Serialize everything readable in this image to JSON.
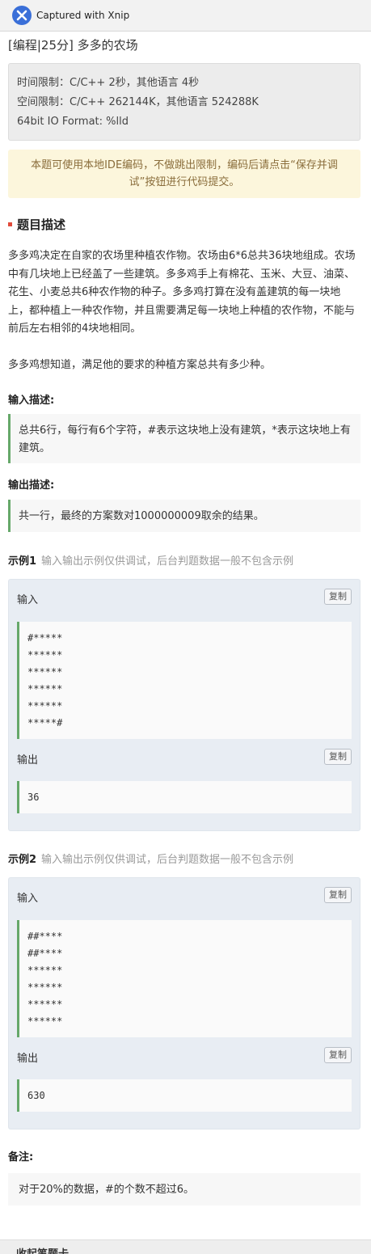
{
  "xnip": {
    "caption": "Captured with Xnip"
  },
  "problem": {
    "title": "[编程|25分] 多多的农场",
    "limits": [
      "时间限制：C/C++ 2秒，其他语言 4秒",
      "空间限制：C/C++ 262144K，其他语言 524288K",
      "64bit IO Format: %lld"
    ],
    "notice": "本题可使用本地IDE编码，不做跳出限制，编码后请点击“保存并调试”按钮进行代码提交。",
    "description_heading": "题目描述",
    "description": [
      "多多鸡决定在自家的农场里种植农作物。农场由6*6总共36块地组成。农场中有几块地上已经盖了一些建筑。多多鸡手上有棉花、玉米、大豆、油菜、花生、小麦总共6种农作物的种子。多多鸡打算在没有盖建筑的每一块地上，都种植上一种农作物，并且需要满足每一块地上种植的农作物，不能与前后左右相邻的4块地相同。",
      "多多鸡想知道，满足他的要求的种植方案总共有多少种。"
    ],
    "input_heading": "输入描述:",
    "input_desc": "总共6行，每行有6个字符，#表示这块地上没有建筑，*表示这块地上有建筑。",
    "output_heading": "输出描述:",
    "output_desc": "共一行，最终的方案数对1000000009取余的结果。",
    "examples": [
      {
        "label": "示例1",
        "hint": "输入输出示例仅供调试，后台判题数据一般不包含示例",
        "input_label": "输入",
        "input": "#*****\n******\n******\n******\n******\n*****#",
        "output_label": "输出",
        "output": "36",
        "copy_label": "复制"
      },
      {
        "label": "示例2",
        "hint": "输入输出示例仅供调试，后台判题数据一般不包含示例",
        "input_label": "输入",
        "input": "##****\n##****\n******\n******\n******\n******",
        "output_label": "输出",
        "output": "630",
        "copy_label": "复制"
      }
    ],
    "note_heading": "备注:",
    "note": "对于20%的数据，#的个数不超过6。"
  },
  "bottom": {
    "label": "收起笔题卡"
  },
  "colors": {
    "accent_red": "#e14b3b",
    "quote_green": "#66a86a",
    "notice_bg": "#fcf6dc",
    "example_bg": "#e8edf3"
  }
}
